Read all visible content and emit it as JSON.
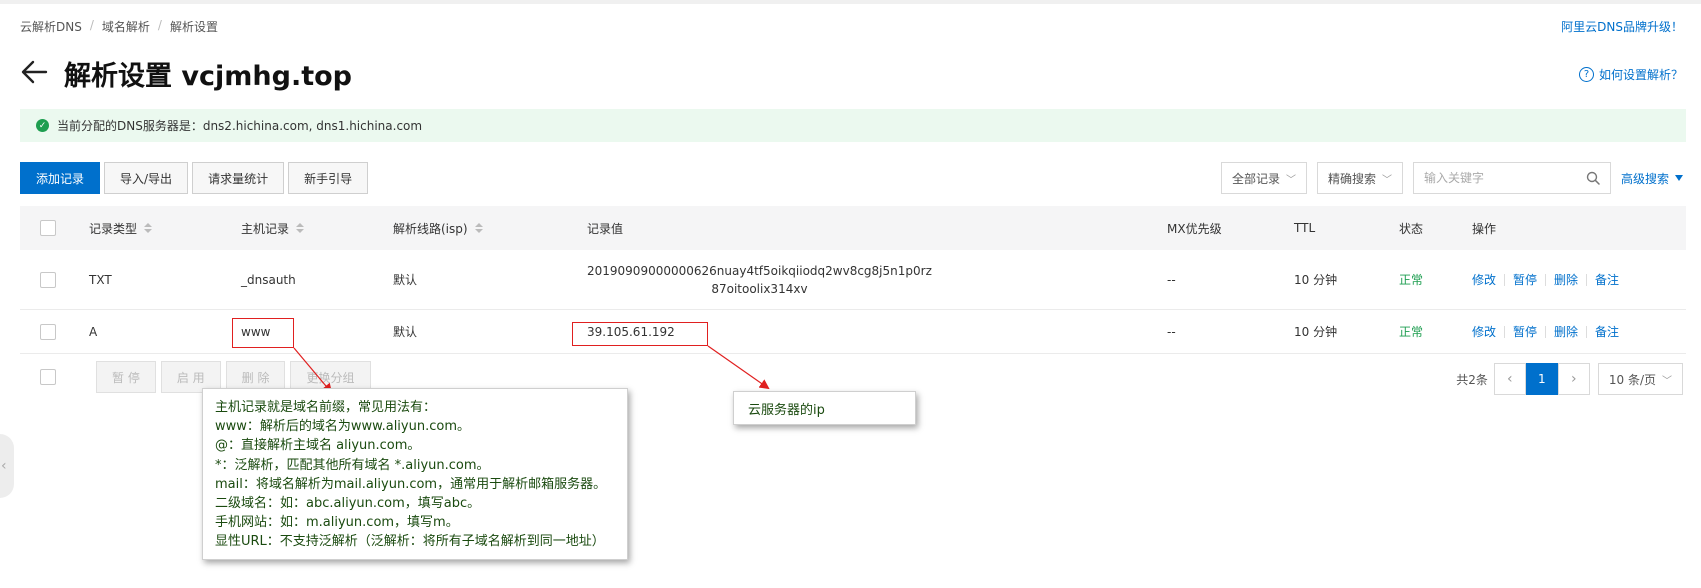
{
  "breadcrumb": [
    "云解析DNS",
    "域名解析",
    "解析设置"
  ],
  "upgrade_link": "阿里云DNS品牌升级！",
  "page_title": "解析设置 vcjmhg.top",
  "help_link": "如何设置解析？",
  "help_icon": "?",
  "notice_text": "当前分配的DNS服务器是：dns2.hichina.com, dns1.hichina.com",
  "notice_icon": "✓",
  "toolbar": {
    "add": "添加记录",
    "import_export": "导入/导出",
    "request_stats": "请求量统计",
    "guide": "新手引导"
  },
  "filters": {
    "all_records": "全部记录",
    "exact_search": "精确搜索",
    "search_placeholder": "输入关键字",
    "advanced_search": "高级搜索"
  },
  "table": {
    "headers": {
      "type": "记录类型",
      "host": "主机记录",
      "line": "解析线路(isp)",
      "value": "记录值",
      "mx": "MX优先级",
      "ttl": "TTL",
      "status": "状态",
      "ops": "操作"
    },
    "rows": [
      {
        "type": "TXT",
        "host": "_dnsauth",
        "line": "默认",
        "value_line1": "20190909000000626nuay4tf5oikqiiodq2wv8cg8j5n1p0rz",
        "value_line2": "87oitoolix314xv",
        "mx": "--",
        "ttl": "10 分钟",
        "status": "正常"
      },
      {
        "type": "A",
        "host": "www",
        "line": "默认",
        "value": "39.105.61.192",
        "mx": "--",
        "ttl": "10 分钟",
        "status": "正常"
      }
    ],
    "ops": {
      "edit": "修改",
      "pause": "暂停",
      "delete": "删除",
      "note": "备注"
    }
  },
  "bulk": {
    "pause": "暂 停",
    "enable": "启 用",
    "delete": "删 除",
    "change_group": "更换分组"
  },
  "pagination": {
    "total": "共2条",
    "current_page": "1",
    "per_page": "10 条/页"
  },
  "annotations": {
    "host_note": [
      "主机记录就是域名前缀，常见用法有：",
      "www：解析后的域名为www.aliyun.com。",
      "@：直接解析主域名 aliyun.com。",
      "*：泛解析，匹配其他所有域名 *.aliyun.com。",
      "mail：将域名解析为mail.aliyun.com，通常用于解析邮箱服务器。",
      "二级域名：如：abc.aliyun.com，填写abc。",
      "手机网站：如：m.aliyun.com，填写m。",
      "显性URL：不支持泛解析（泛解析：将所有子域名解析到同一地址）"
    ],
    "ip_note": "云服务器的ip"
  },
  "colors": {
    "primary": "#0070cc",
    "success": "#1e9e50",
    "annotation_red": "#e02020",
    "annotation_text": "#1a4a0f"
  }
}
